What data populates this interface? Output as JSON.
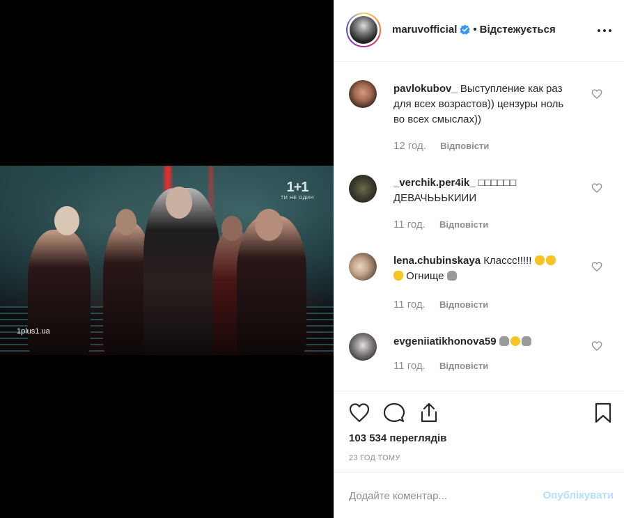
{
  "media": {
    "channel_logo": "1+1",
    "channel_tagline": "ТИ НЕ ОДИН",
    "watermark": "1plus1.ua"
  },
  "header": {
    "username": "maruvofficial",
    "separator": "•",
    "follow_state": "Відстежується",
    "verified_color": "#3897f0"
  },
  "comments": [
    {
      "username": "pavlokubov_",
      "text": "Выступление как раз для всех возрастов)) цензуры ноль во всех смыслах))",
      "time": "12 год.",
      "reply": "Відповісти"
    },
    {
      "username": "_verchik.per4ik_",
      "text": "□□□□□□ ДЕВАЧЬЬЬКИИИ",
      "time": "11 год.",
      "reply": "Відповісти"
    },
    {
      "username": "lena.chubinskaya",
      "text": "Классс!!!!!",
      "text2": "Огнище",
      "time": "11 год.",
      "reply": "Відповісти"
    },
    {
      "username": "evgeniiatikhonova59",
      "text": "",
      "time": "11 год.",
      "reply": "Відповісти"
    }
  ],
  "stats": {
    "views": "103 534 переглядів",
    "time_ago": "23 ГОД ТОМУ"
  },
  "composer": {
    "placeholder": "Додайте коментар...",
    "publish_label": "Опублікувати",
    "publish_color": "#b2dffc"
  }
}
